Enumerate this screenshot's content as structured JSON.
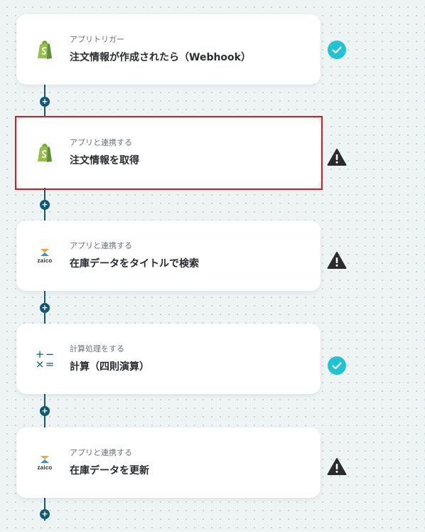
{
  "steps": [
    {
      "subtitle": "アプリトリガー",
      "title": "注文情報が作成されたら（Webhook）",
      "icon": "shopify-icon",
      "status": "complete"
    },
    {
      "subtitle": "アプリと連携する",
      "title": "注文情報を取得",
      "icon": "shopify-icon",
      "status": "warning"
    },
    {
      "subtitle": "アプリと連携する",
      "title": "在庫データをタイトルで検索",
      "icon": "zaico-icon",
      "icon_text": "zaico",
      "status": "warning"
    },
    {
      "subtitle": "計算処理をする",
      "title": "計算（四則演算）",
      "icon": "calculator-operators-icon",
      "icon_symbols": [
        "+",
        "−",
        "×",
        "="
      ],
      "status": "complete"
    },
    {
      "subtitle": "アプリと連携する",
      "title": "在庫データを更新",
      "icon": "zaico-icon",
      "icon_text": "zaico",
      "status": "warning"
    }
  ],
  "add_button_symbol": "+",
  "colors": {
    "flow_line": "#0e5a73",
    "complete": "#20c3d4",
    "warning": "#2b2b2b",
    "selected_border": "#d61c22",
    "shopify": "#95bf47",
    "zaico_orange": "#f2a33a",
    "zaico_blue": "#3c8fd8"
  }
}
